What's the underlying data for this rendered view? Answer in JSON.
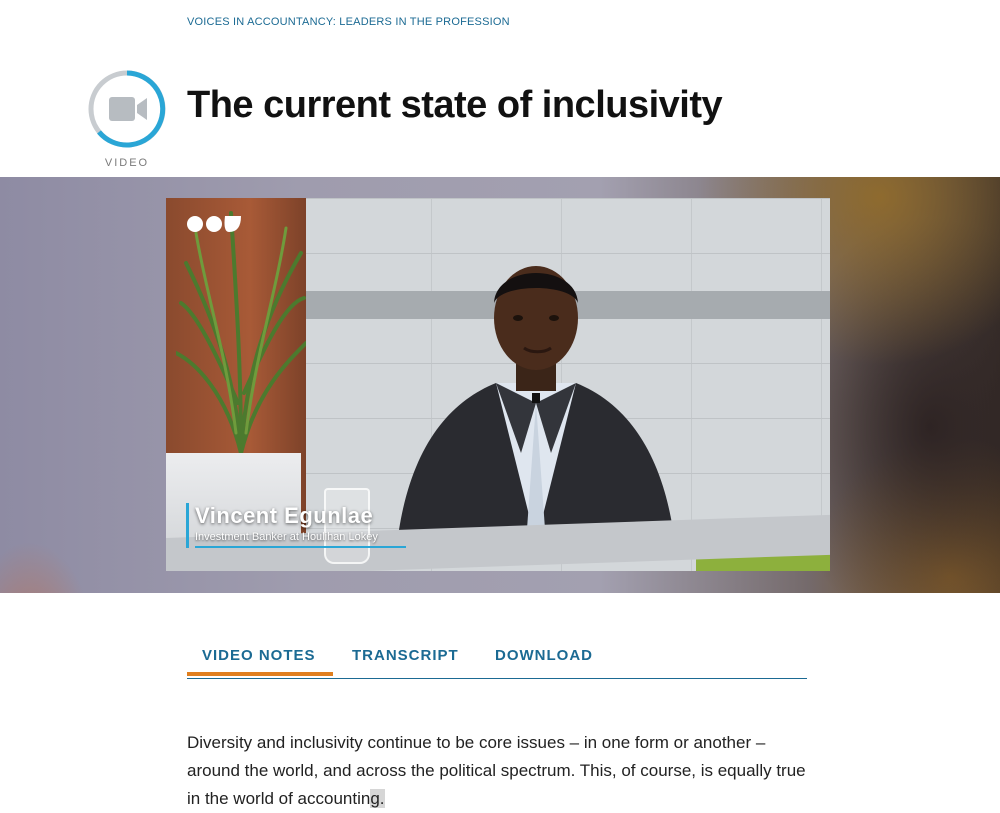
{
  "eyebrow": "VOICES IN ACCOUNTANCY: LEADERS IN THE PROFESSION",
  "badge": {
    "label": "VIDEO",
    "icon": "video-camera-icon"
  },
  "title": "The current state of inclusivity",
  "video": {
    "speaker_name": "Vincent Egunlae",
    "speaker_role": "Investment Banker at Houlihan Lokey",
    "logo_icon": "brand-logo-icon"
  },
  "tabs": [
    {
      "label": "VIDEO NOTES",
      "active": true
    },
    {
      "label": "TRANSCRIPT",
      "active": false
    },
    {
      "label": "DOWNLOAD",
      "active": false
    }
  ],
  "body": {
    "paragraph_main": "Diversity and inclusivity continue to be core issues – in one form or another – around the world, and across the political spectrum. This, of course, is equally true in the world of accountin",
    "paragraph_highlight": "g."
  },
  "colors": {
    "accent_blue": "#1b6a93",
    "accent_orange": "#e07f1f",
    "lower_third_blue": "#2aa6d6"
  }
}
